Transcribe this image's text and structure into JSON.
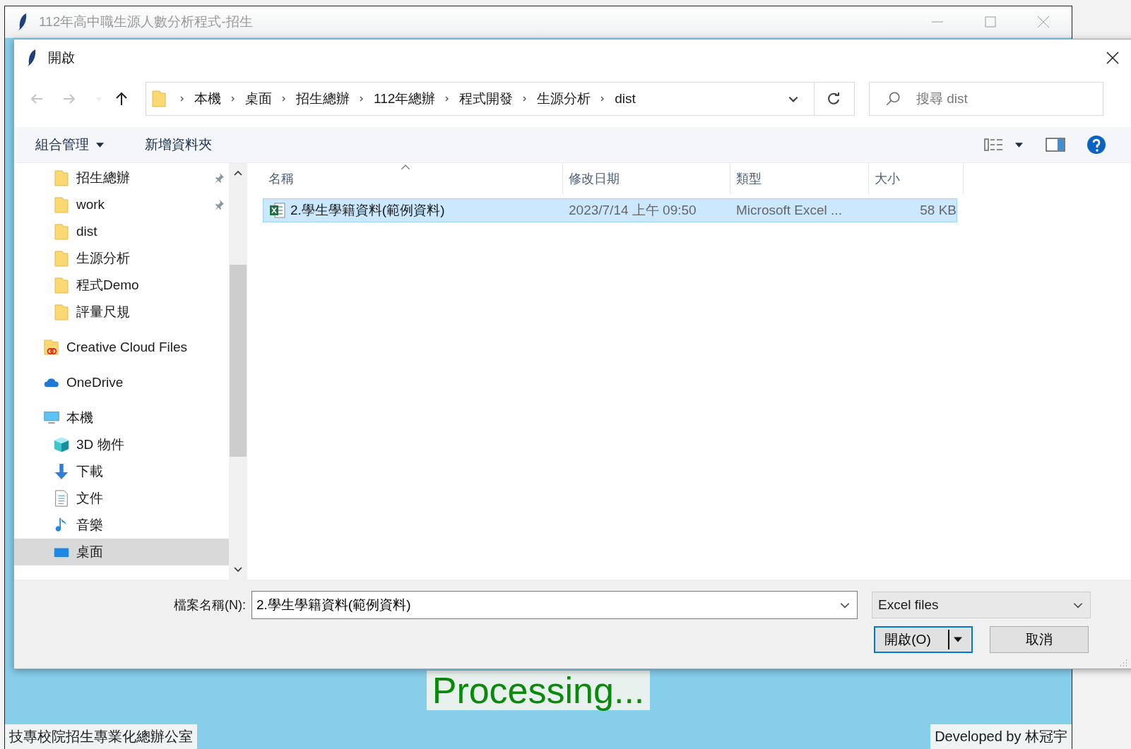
{
  "app_window": {
    "title": "112年高中職生源人數分析程式-招生",
    "status": "Processing...",
    "footer_left": "技專校院招生專業化總辦公室",
    "footer_right": "Developed by 林冠宇"
  },
  "dialog": {
    "title": "開啟",
    "nav_buttons": [
      {
        "kind": "back",
        "disabled": true
      },
      {
        "kind": "forward",
        "disabled": true
      },
      {
        "kind": "recent",
        "disabled": true
      },
      {
        "kind": "up",
        "disabled": false
      }
    ],
    "breadcrumb": [
      "本機",
      "桌面",
      "招生總辦",
      "112年總辦",
      "程式開發",
      "生源分析",
      "dist"
    ],
    "search": {
      "placeholder": "搜尋 dist"
    },
    "toolbar": {
      "organize": "組合管理",
      "new_folder": "新增資料夾"
    },
    "nav": {
      "quick_access": [
        {
          "label": "招生總辦",
          "kind": "folder",
          "pinned": true,
          "selected": false
        },
        {
          "label": "work",
          "kind": "folder",
          "pinned": true,
          "selected": false
        },
        {
          "label": "dist",
          "kind": "folder",
          "pinned": false,
          "selected": false
        },
        {
          "label": "生源分析",
          "kind": "folder",
          "pinned": false,
          "selected": false
        },
        {
          "label": "程式Demo",
          "kind": "folder",
          "pinned": false,
          "selected": false
        },
        {
          "label": "評量尺規",
          "kind": "folder",
          "pinned": false,
          "selected": false
        }
      ],
      "items": [
        {
          "label": "Creative Cloud Files",
          "kind": "creative-cloud",
          "selected": false
        },
        {
          "label": "OneDrive",
          "kind": "onedrive",
          "selected": false
        },
        {
          "label": "本機",
          "kind": "pc",
          "selected": false,
          "children": [
            {
              "label": "3D 物件",
              "kind": "cube",
              "selected": false
            },
            {
              "label": "下載",
              "kind": "download",
              "selected": false
            },
            {
              "label": "文件",
              "kind": "document",
              "selected": false
            },
            {
              "label": "音樂",
              "kind": "music",
              "selected": false
            },
            {
              "label": "桌面",
              "kind": "desktop",
              "selected": true
            }
          ]
        }
      ]
    },
    "columns": [
      {
        "label": "名稱",
        "sorted": true
      },
      {
        "label": "修改日期",
        "sorted": false
      },
      {
        "label": "類型",
        "sorted": false
      },
      {
        "label": "大小",
        "sorted": false
      }
    ],
    "files": [
      {
        "name": "2.學生學籍資料(範例資料)",
        "modified": "2023/7/14 上午 09:50",
        "type": "Microsoft Excel ...",
        "size": "58 KB",
        "selected": true
      }
    ],
    "file_name": {
      "label": "檔案名稱(N):",
      "value": "2.學生學籍資料(範例資料)"
    },
    "file_type": "Excel files",
    "buttons": [
      {
        "label": "開啟(O)",
        "kind": "split",
        "default": true
      },
      {
        "label": "取消",
        "kind": "plain",
        "default": false
      }
    ]
  }
}
